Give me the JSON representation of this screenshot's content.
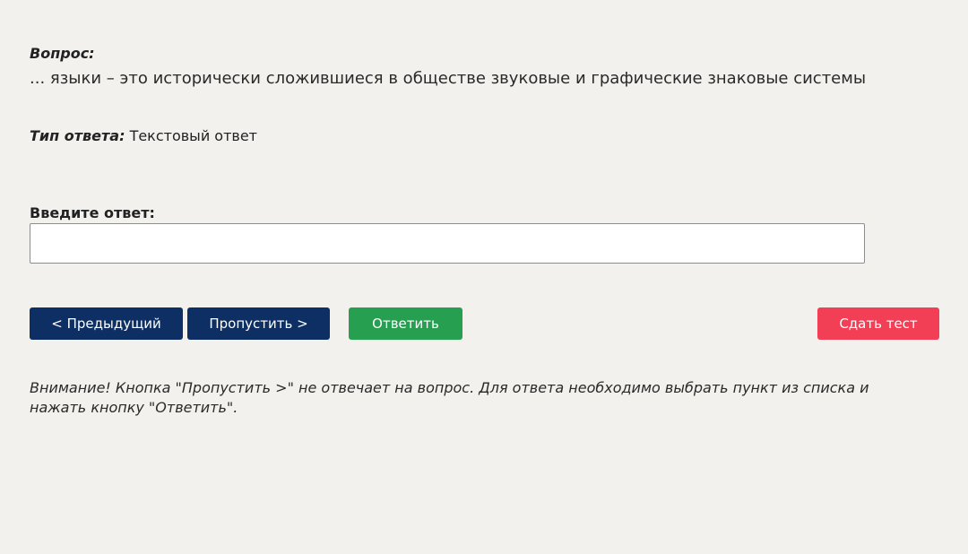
{
  "question": {
    "label": "Вопрос:",
    "text": "... языки – это исторически сложившиеся в обществе звуковые и графические знаковые системы"
  },
  "answer_type": {
    "label": "Тип ответа:",
    "value": "Текстовый ответ"
  },
  "answer_input": {
    "label": "Введите ответ:",
    "value": "",
    "placeholder": ""
  },
  "buttons": {
    "prev": "< Предыдущий",
    "skip": "Пропустить >",
    "answer": "Ответить",
    "finish": "Сдать тест"
  },
  "notice": "Внимание! Кнопка \"Пропустить >\" не отвечает на вопрос. Для ответа необходимо выбрать пункт из списка и нажать кнопку \"Ответить\".",
  "colors": {
    "background": "#f2f1ee",
    "nav_button": "#0d2f63",
    "answer_button": "#26a050",
    "finish_button": "#f33f55"
  }
}
